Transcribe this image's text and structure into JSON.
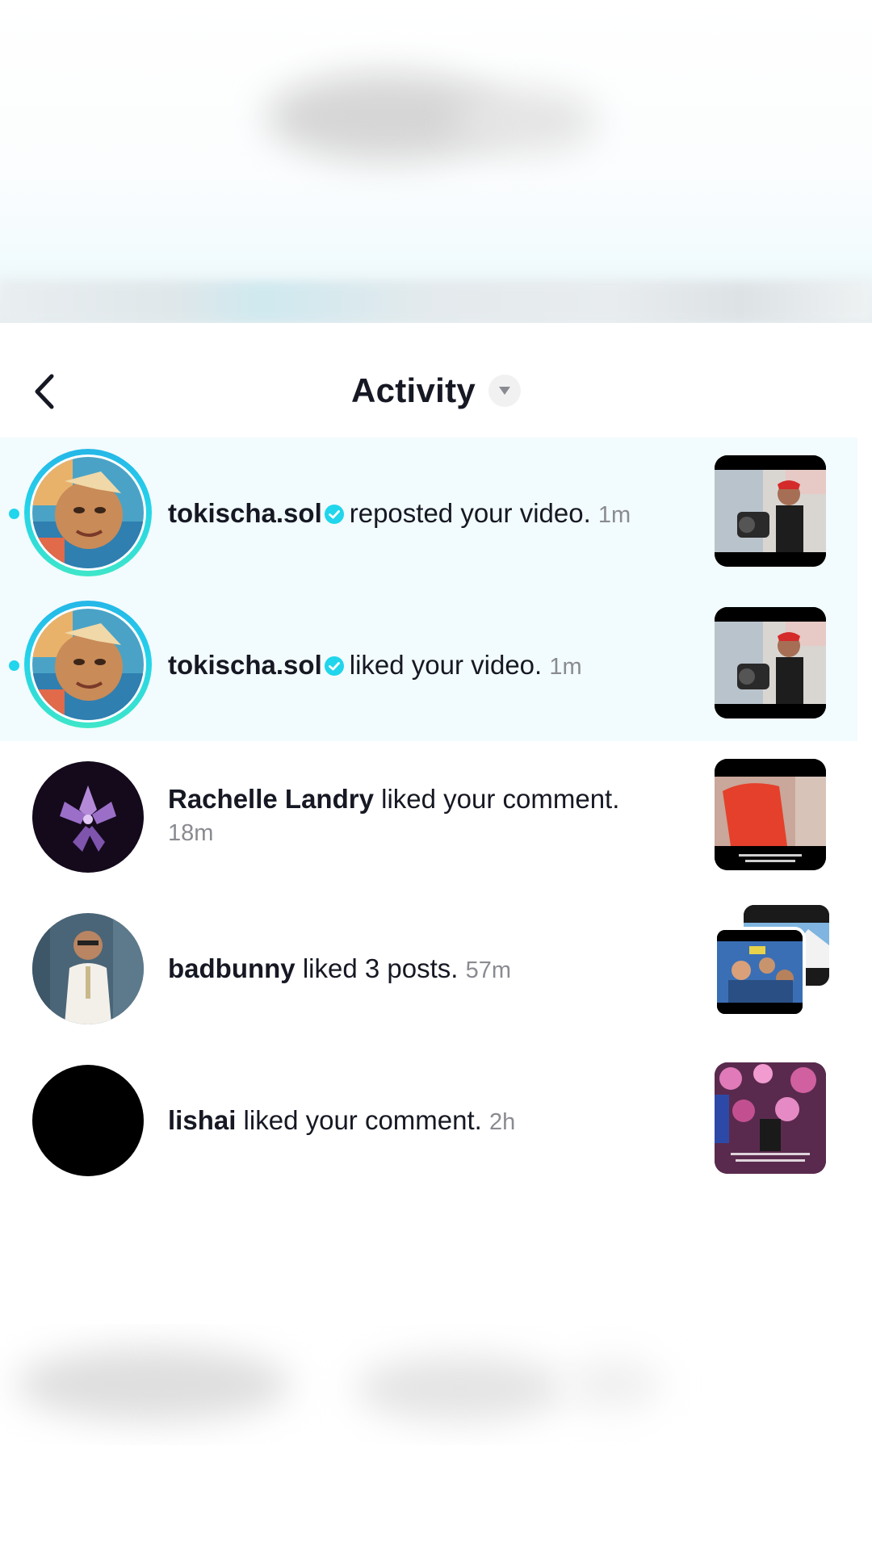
{
  "header": {
    "title": "Activity",
    "icons": {
      "back": "chevron-left-icon",
      "dropdown": "triangle-down-icon"
    }
  },
  "notifications": [
    {
      "username": "tokischa.sol",
      "verified": true,
      "action": "reposted your video.",
      "time": "1m",
      "unread": true
    },
    {
      "username": "tokischa.sol",
      "verified": true,
      "action": "liked your video.",
      "time": "1m",
      "unread": true
    },
    {
      "username": "Rachelle Landry",
      "verified": false,
      "action": "liked your comment.",
      "time": "18m",
      "unread": false
    },
    {
      "username": "badbunny",
      "verified": false,
      "action": "liked 3 posts.",
      "time": "57m",
      "unread": false
    },
    {
      "username": "lishai",
      "verified": false,
      "action": "liked your comment.",
      "time": "2h",
      "unread": false
    }
  ],
  "colors": {
    "accent": "#20d5ec",
    "unread_row_bg": "#f2fbfd",
    "verified_badge": "#20d5ec",
    "time_text": "#8a8b91"
  }
}
